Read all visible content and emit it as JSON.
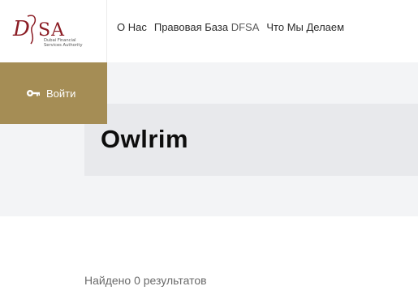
{
  "header": {
    "logo_text": "DFSA",
    "logo_subtitle": "Dubai Financial Services Authority",
    "nav": [
      {
        "label": "О Нас"
      },
      {
        "label": "Правовая База",
        "accent": "DFSA"
      },
      {
        "label": "Что Мы Делаем"
      }
    ]
  },
  "login": {
    "label": "Войти",
    "icon": "key-icon"
  },
  "hero": {
    "title": "Owlrim"
  },
  "results": {
    "summary": "Найдено 0 результатов"
  },
  "colors": {
    "brand_gold": "#a58d55",
    "logo_red": "#8b1c24",
    "hero_bg": "#f3f4f6",
    "title_card_bg": "#e8e9ec"
  }
}
